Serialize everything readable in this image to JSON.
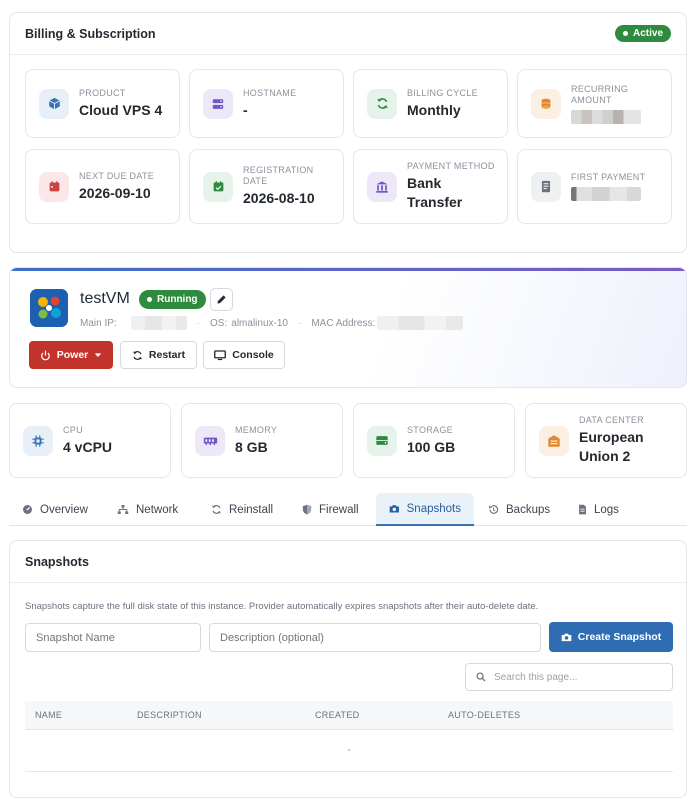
{
  "billing": {
    "title": "Billing & Subscription",
    "status": "Active",
    "tiles": [
      {
        "label": "PRODUCT",
        "value": "Cloud VPS 4",
        "icon": "box-icon"
      },
      {
        "label": "HOSTNAME",
        "value": "-",
        "icon": "server-icon"
      },
      {
        "label": "BILLING CYCLE",
        "value": "Monthly",
        "icon": "refresh-icon"
      },
      {
        "label": "RECURRING AMOUNT",
        "value": "",
        "icon": "coins-icon"
      },
      {
        "label": "NEXT DUE DATE",
        "value": "2026-09-10",
        "icon": "calendar-icon"
      },
      {
        "label": "REGISTRATION DATE",
        "value": "2026-08-10",
        "icon": "calendar-check-icon"
      },
      {
        "label": "PAYMENT METHOD",
        "value": "Bank Transfer",
        "icon": "bank-icon"
      },
      {
        "label": "FIRST PAYMENT",
        "value": "",
        "icon": "receipt-icon"
      }
    ]
  },
  "vm": {
    "name": "testVM",
    "status": "Running",
    "main_ip_label": "Main IP:",
    "os_label": "OS:",
    "os_value": "almalinux-10",
    "mac_label": "MAC Address:",
    "buttons": {
      "power": "Power",
      "restart": "Restart",
      "console": "Console"
    }
  },
  "stats": [
    {
      "label": "CPU",
      "value": "4 vCPU",
      "icon": "cpu-icon"
    },
    {
      "label": "MEMORY",
      "value": "8 GB",
      "icon": "memory-icon"
    },
    {
      "label": "STORAGE",
      "value": "100 GB",
      "icon": "storage-icon"
    },
    {
      "label": "DATA CENTER",
      "value": "European Union 2",
      "icon": "datacenter-icon"
    }
  ],
  "tabs": [
    {
      "label": "Overview",
      "icon": "gauge-icon"
    },
    {
      "label": "Network",
      "icon": "network-icon"
    },
    {
      "label": "Reinstall",
      "icon": "reinstall-icon"
    },
    {
      "label": "Firewall",
      "icon": "shield-icon"
    },
    {
      "label": "Snapshots",
      "icon": "camera-icon",
      "active": true
    },
    {
      "label": "Backups",
      "icon": "history-icon"
    },
    {
      "label": "Logs",
      "icon": "file-icon"
    }
  ],
  "snapshots": {
    "title": "Snapshots",
    "description": "Snapshots capture the full disk state of this instance. Provider automatically expires snapshots after their auto-delete date.",
    "name_placeholder": "Snapshot Name",
    "desc_placeholder": "Description (optional)",
    "create_label": "Create Snapshot",
    "search_placeholder": "Search this page...",
    "columns": [
      "NAME",
      "DESCRIPTION",
      "CREATED",
      "AUTO-DELETES"
    ],
    "empty_value": "-"
  },
  "colors": {
    "accent": "#2f6db3",
    "success": "#2e8b3e",
    "danger": "#c2332b"
  }
}
